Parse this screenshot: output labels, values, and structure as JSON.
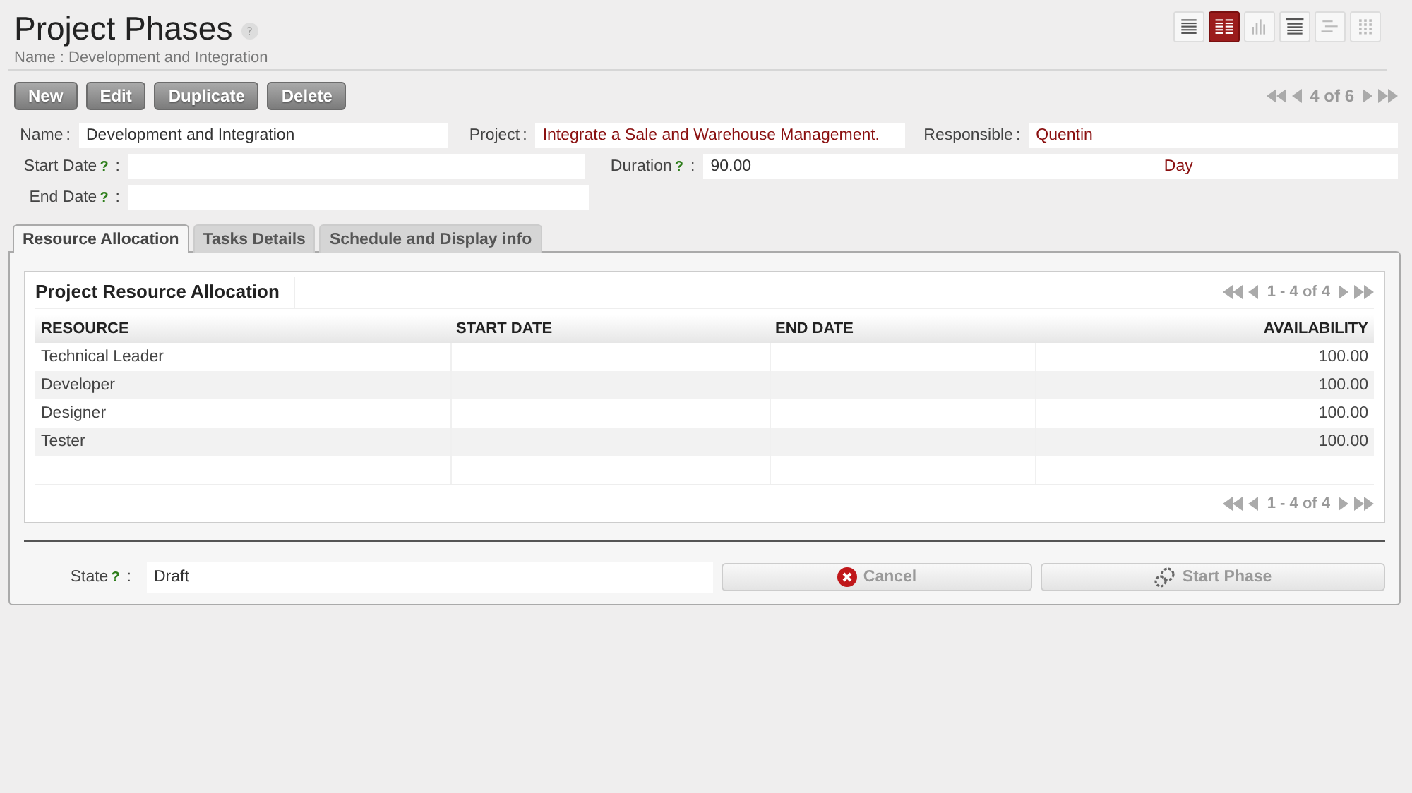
{
  "header": {
    "title": "Project Phases",
    "help": "?",
    "subtitle": "Name : Development and Integration"
  },
  "views": [
    {
      "kind": "list",
      "selected": false
    },
    {
      "kind": "form",
      "selected": true
    },
    {
      "kind": "graph",
      "selected": false
    },
    {
      "kind": "calendar",
      "selected": false
    },
    {
      "kind": "gantt",
      "selected": false
    },
    {
      "kind": "kanban",
      "selected": false
    }
  ],
  "actions": [
    "New",
    "Edit",
    "Duplicate",
    "Delete"
  ],
  "pager": {
    "text": "4 of 6"
  },
  "field_rows": [
    [
      {
        "label": "Name",
        "colon": ":",
        "value": "Development and Integration",
        "kind": "text"
      },
      {
        "label": "Project",
        "colon": ":",
        "value": "Integrate a Sale and Warehouse Management.",
        "kind": "link"
      },
      {
        "label": "Responsible",
        "colon": ":",
        "value": "Quentin",
        "kind": "link"
      }
    ],
    [
      {
        "label": "Start Date",
        "help": "?",
        "colon": ":",
        "kind": "text"
      },
      {
        "label": "Duration",
        "help": "?",
        "colon": ":",
        "value": "90.00",
        "kind": "text",
        "unit": "Day"
      }
    ],
    [
      {
        "label": "End Date",
        "help": "?",
        "colon": ":",
        "kind": "text"
      }
    ]
  ],
  "tabs": [
    {
      "label": "Resource Allocation",
      "selected": true
    },
    {
      "label": "Tasks Details",
      "selected": false
    },
    {
      "label": "Schedule and Display info",
      "selected": false
    }
  ],
  "grid": {
    "title": "Project Resource Allocation",
    "pager": "1 - 4 of 4",
    "bottom_pager": "1 - 4 of 4",
    "columns": [
      {
        "label": "RESOURCE"
      },
      {
        "label": "START DATE"
      },
      {
        "label": "END DATE"
      },
      {
        "label": "AVAILABILITY"
      }
    ],
    "rows": [
      [
        "Technical Leader",
        "",
        "",
        "100.00"
      ],
      [
        "Developer",
        "",
        "",
        "100.00"
      ],
      [
        "Designer",
        "",
        "",
        "100.00"
      ],
      [
        "Tester",
        "",
        "",
        "100.00"
      ]
    ]
  },
  "state": {
    "label": "State",
    "help": "?",
    "colon": ":",
    "value": "Draft"
  },
  "state_buttons": [
    {
      "label": "Cancel",
      "kind": "cancel"
    },
    {
      "label": "Start Phase",
      "kind": "start"
    }
  ]
}
